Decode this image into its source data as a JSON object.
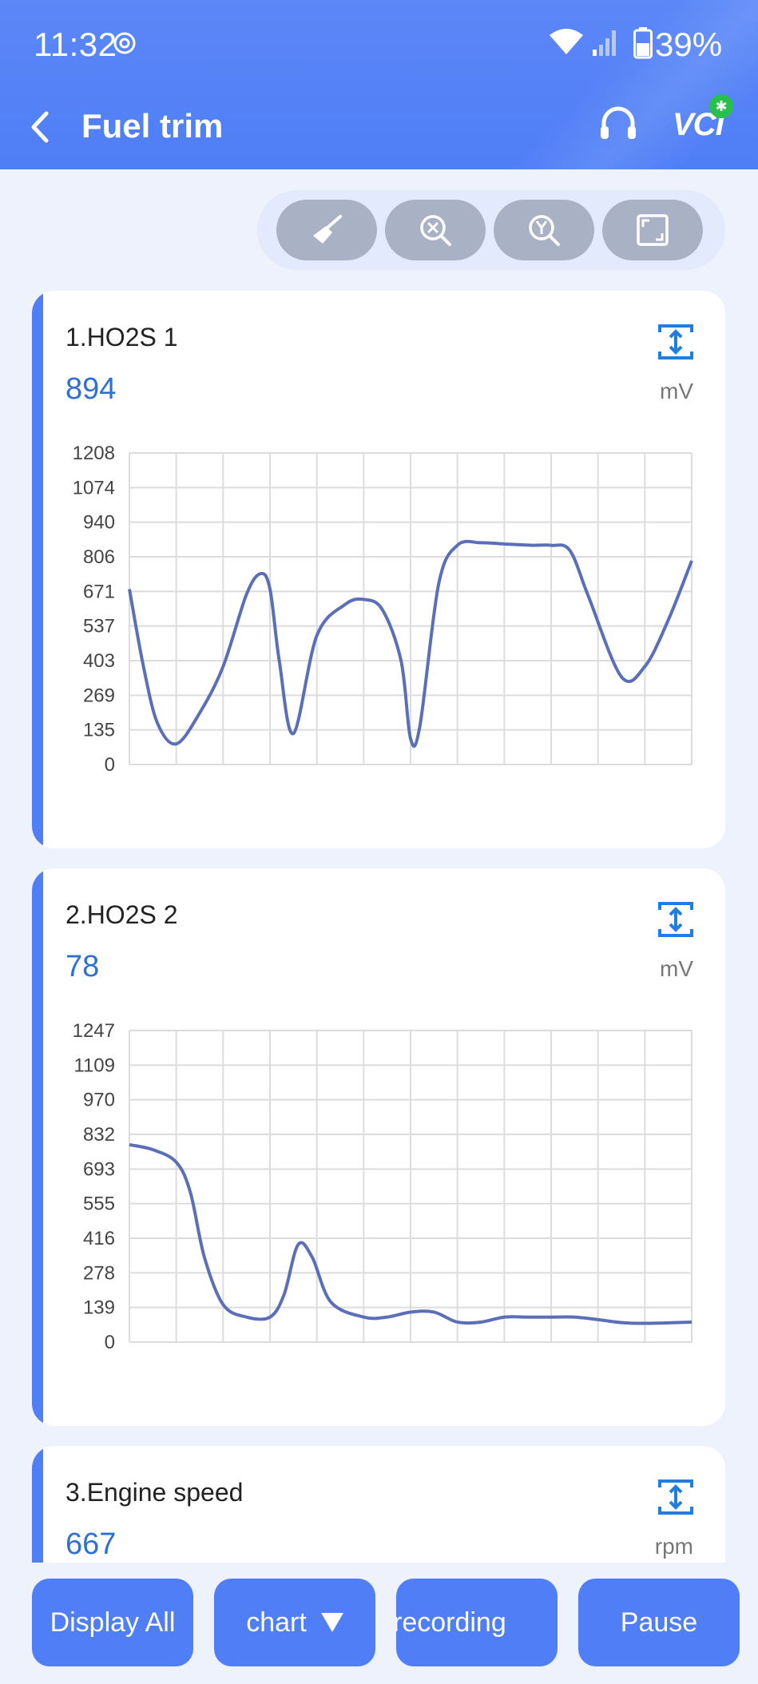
{
  "status_bar": {
    "time": "11:32",
    "battery": "39%"
  },
  "header": {
    "title": "Fuel trim",
    "vci_label": "VCI"
  },
  "toolbar": {
    "buttons": [
      "broom-icon",
      "zoom-reset-icon",
      "zoom-y-icon",
      "fit-screen-icon"
    ]
  },
  "cards": [
    {
      "name": "1.HO2S 1",
      "value": "894",
      "unit": "mV"
    },
    {
      "name": "2.HO2S 2",
      "value": "78",
      "unit": "mV"
    },
    {
      "name": "3.Engine speed",
      "value": "667",
      "unit": "rpm"
    }
  ],
  "chart_data": [
    {
      "type": "line",
      "ylim": [
        0,
        1208
      ],
      "yticks": [
        "1208",
        "1074",
        "940",
        "806",
        "671",
        "537",
        "403",
        "269",
        "135",
        "0"
      ],
      "x": [
        0,
        0.3,
        0.6,
        1.0,
        1.5,
        2.0,
        2.5,
        2.8,
        3.0,
        3.2,
        3.5,
        4.0,
        4.6,
        5.0,
        5.4,
        5.8,
        6.0,
        6.2,
        6.6,
        7.0,
        7.5,
        8.0,
        8.6,
        9.0,
        9.4,
        9.8,
        10.5,
        11.0,
        11.5,
        12.0
      ],
      "values": [
        680,
        380,
        160,
        80,
        200,
        380,
        660,
        740,
        680,
        400,
        120,
        500,
        620,
        640,
        600,
        400,
        100,
        150,
        700,
        850,
        860,
        855,
        850,
        850,
        830,
        650,
        340,
        380,
        560,
        790
      ],
      "grid": true
    },
    {
      "type": "line",
      "ylim": [
        0,
        1247
      ],
      "yticks": [
        "1247",
        "1109",
        "970",
        "832",
        "693",
        "555",
        "416",
        "278",
        "139",
        "0"
      ],
      "x": [
        0,
        0.5,
        1.0,
        1.3,
        1.6,
        2.0,
        2.5,
        3.0,
        3.3,
        3.6,
        3.9,
        4.3,
        5.0,
        5.5,
        6.0,
        6.5,
        7.0,
        7.5,
        8.0,
        8.5,
        9.0,
        9.5,
        10.0,
        10.5,
        11.0,
        12.0
      ],
      "values": [
        790,
        770,
        720,
        600,
        340,
        150,
        100,
        100,
        190,
        390,
        340,
        160,
        100,
        100,
        120,
        120,
        80,
        80,
        100,
        100,
        100,
        100,
        90,
        78,
        75,
        80
      ],
      "grid": true
    }
  ],
  "bottom_buttons": {
    "display_all": "Display All",
    "chart": "chart",
    "recording": "recording",
    "pause": "Pause"
  }
}
